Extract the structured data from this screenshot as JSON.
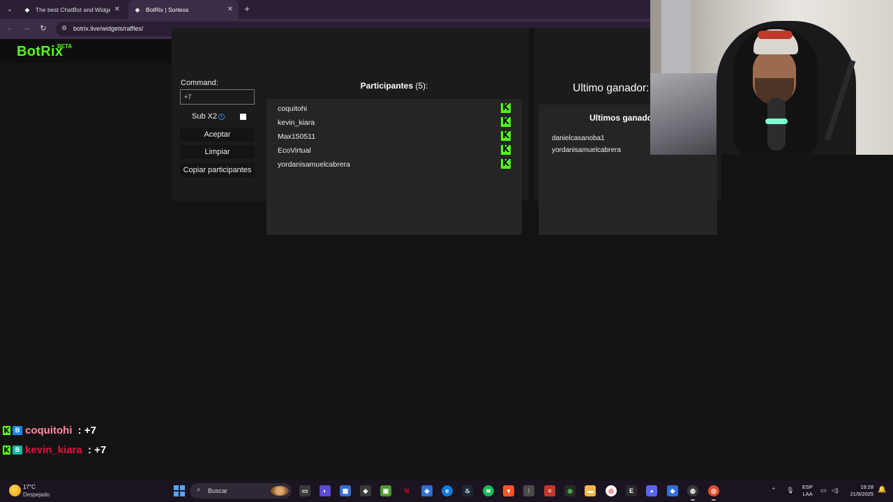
{
  "browser": {
    "tabs": [
      {
        "title": "The best ChatBot and Widgets",
        "active": false
      },
      {
        "title": "BotRix | Sorteos",
        "active": true
      }
    ],
    "url": "botrix.live/widgets/raffles/"
  },
  "site": {
    "logo": "BotRix",
    "logo_badge": "BETA"
  },
  "raffle": {
    "command_label": "Command:",
    "command_value": "+7",
    "sub_x2_label": "Sub X2",
    "sub_x2_checked": false,
    "buttons": {
      "accept": "Aceptar",
      "clear": "Limpiar",
      "copy": "Copiar participantes"
    },
    "participants_title": "Participantes",
    "participants_count": "(5):",
    "participants": [
      {
        "name": "coquitohi"
      },
      {
        "name": "kevin_kiara"
      },
      {
        "name": "Max150511"
      },
      {
        "name": "EcoVirtual"
      },
      {
        "name": "yordanisamuelcabrera"
      }
    ],
    "last_winner_label": "Ultimo ganador:",
    "winners_title": "Ultimos ganado",
    "winners": [
      "danielcasanoba1",
      "yordanisamuelcabrera"
    ]
  },
  "chat": [
    {
      "user": "coquitohi",
      "message": " : +7",
      "color": "#ff8fa3",
      "badge": "B"
    },
    {
      "user": "kevin_kiara",
      "message": " : +7",
      "color": "#e0143c",
      "badge": "B"
    }
  ],
  "taskbar": {
    "weather_temp": "17°C",
    "weather_desc": "Despejado",
    "search_placeholder": "Buscar",
    "lang_top": "ESP",
    "lang_bottom": "LAA",
    "time": "19:28",
    "date": "21/9/2025"
  },
  "colors": {
    "accent": "#53fc18",
    "panel": "#1b1b1b",
    "list_bg": "#252525"
  }
}
